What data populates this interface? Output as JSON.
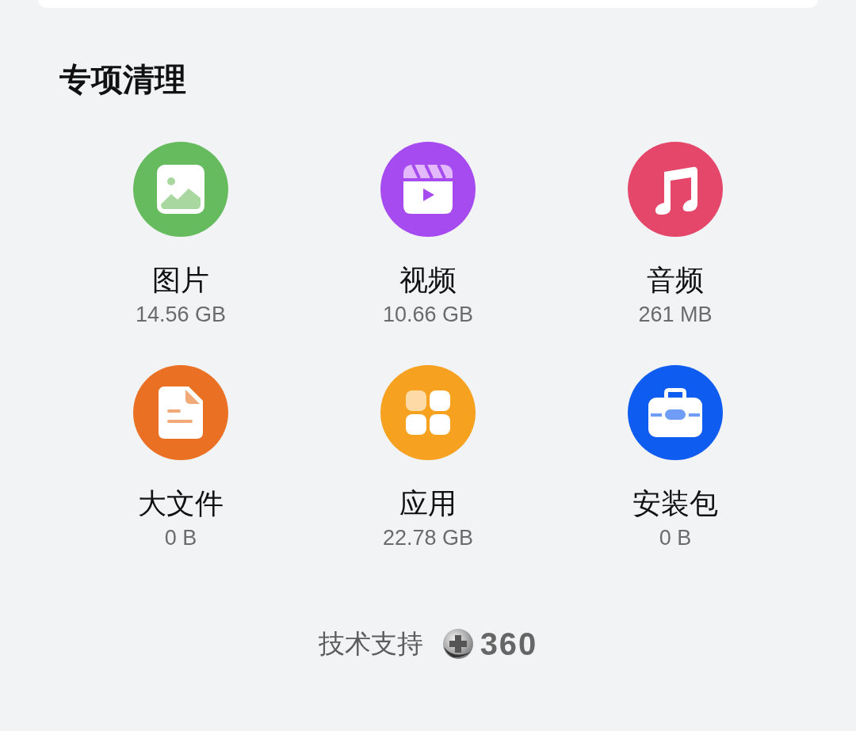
{
  "section_title": "专项清理",
  "items": [
    {
      "kind": "image",
      "color": "#66bb5e",
      "label": "图片",
      "size": "14.56 GB"
    },
    {
      "kind": "video",
      "color": "#a64bf0",
      "label": "视频",
      "size": "10.66 GB"
    },
    {
      "kind": "audio",
      "color": "#e4476a",
      "label": "音频",
      "size": "261 MB"
    },
    {
      "kind": "file",
      "color": "#ea7124",
      "label": "大文件",
      "size": "0 B"
    },
    {
      "kind": "apps",
      "color": "#f6a11f",
      "label": "应用",
      "size": "22.78 GB"
    },
    {
      "kind": "package",
      "color": "#0e5cf0",
      "label": "安装包",
      "size": "0 B"
    }
  ],
  "footer": {
    "text": "技术支持",
    "logo_text": "360"
  }
}
